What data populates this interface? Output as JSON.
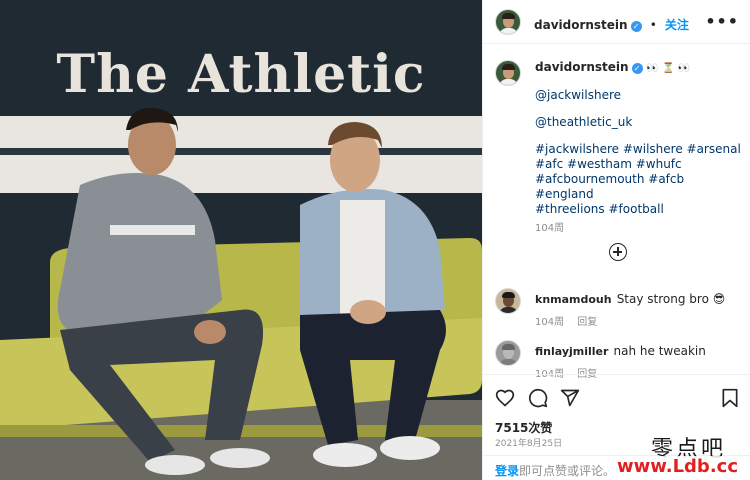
{
  "photo": {
    "sign_text": "The Athletic"
  },
  "header": {
    "username": "davidornstein",
    "follow_label": "关注",
    "more_label": "•••"
  },
  "caption": {
    "username": "davidornstein",
    "emojis": "👀 ⏳ 👀",
    "mention_1": "@jackwilshere",
    "mention_2": "@theathletic_uk",
    "hashtags_line1": "#jackwilshere #wilshere #arsenal",
    "hashtags_line2": "#afc #westham #whufc",
    "hashtags_line3": "#afcbournemouth #afcb #england",
    "hashtags_line4": "#threelions #football",
    "time": "104周"
  },
  "comments": [
    {
      "username": "knmamdouh",
      "text": "Stay strong bro 😎",
      "time": "104周",
      "reply": "回复"
    },
    {
      "username": "finlayjmiller",
      "text": "nah he tweakin",
      "time": "104周",
      "reply": "回复"
    }
  ],
  "footer": {
    "likes": "7515次赞",
    "date": "2021年8月25日",
    "login_link": "登录",
    "login_rest": "即可点赞或评论。"
  },
  "watermark": {
    "cn": "零点吧",
    "url": "www.Ldb.cc"
  },
  "colors": {
    "link_blue": "#0095f6",
    "hashtag_blue": "#00376b",
    "watermark_red": "#e02020"
  }
}
